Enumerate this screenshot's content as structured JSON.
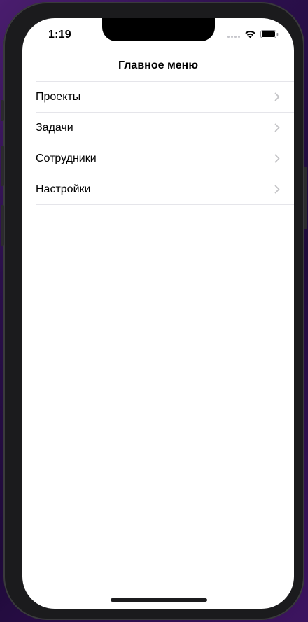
{
  "status_bar": {
    "time": "1:19"
  },
  "navigation": {
    "title": "Главное меню"
  },
  "menu": {
    "items": [
      {
        "label": "Проекты"
      },
      {
        "label": "Задачи"
      },
      {
        "label": "Сотрудники"
      },
      {
        "label": "Настройки"
      }
    ]
  }
}
